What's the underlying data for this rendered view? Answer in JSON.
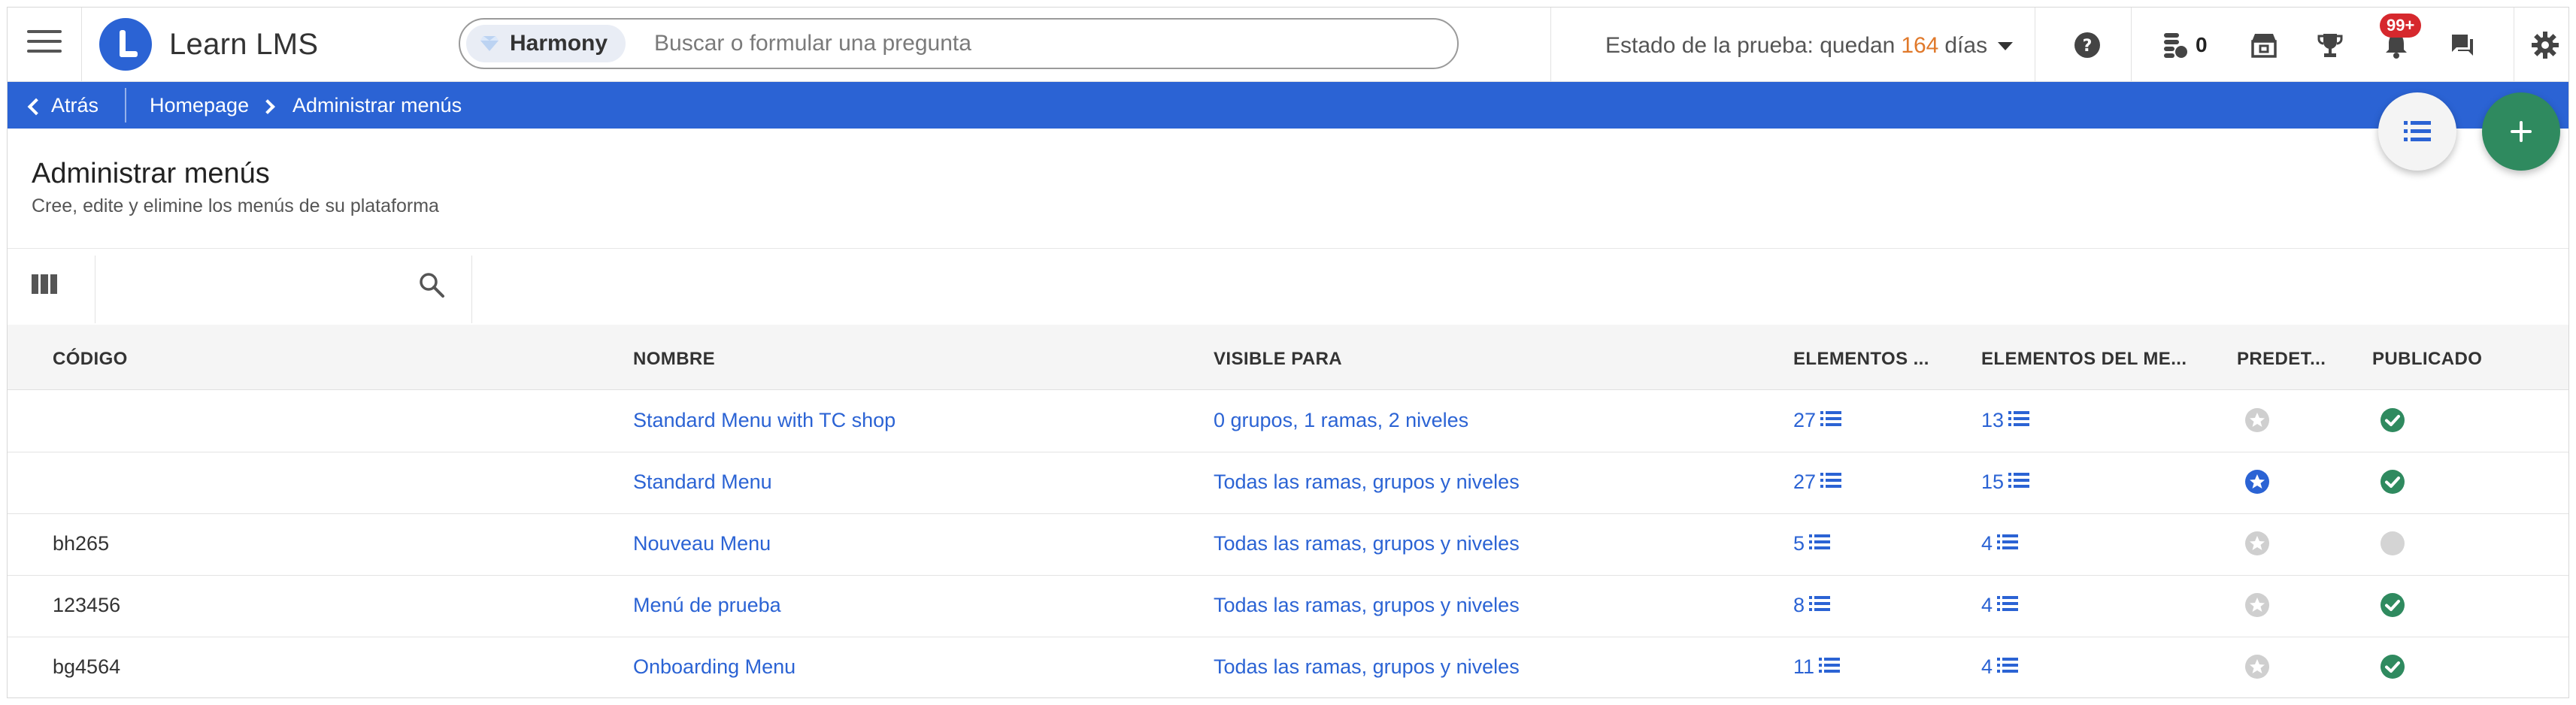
{
  "app": {
    "name": "Learn LMS"
  },
  "header": {
    "search_pill": "Harmony",
    "search_placeholder": "Buscar o formular una pregunta",
    "trial_prefix": "Estado de la prueba: quedan",
    "trial_days": "164",
    "trial_suffix": "días",
    "credits_count": "0",
    "notifications_badge": "99+"
  },
  "breadcrumb": {
    "back_label": "Atrás",
    "items": [
      "Homepage",
      "Administrar menús"
    ]
  },
  "page": {
    "title": "Administrar menús",
    "subtitle": "Cree, edite y elimine los menús de su plataforma"
  },
  "table": {
    "columns": [
      "CÓDIGO",
      "NOMBRE",
      "VISIBLE PARA",
      "ELEMENTOS ...",
      "ELEMENTOS DEL ME...",
      "PREDET...",
      "PUBLICADO"
    ],
    "rows": [
      {
        "code": "",
        "name": "Standard Menu with TC shop",
        "visible": "0 grupos, 1 ramas, 2 niveles",
        "items": "27",
        "menu_items": "13",
        "default": false,
        "published": true
      },
      {
        "code": "",
        "name": "Standard Menu",
        "visible": "Todas las ramas, grupos y niveles",
        "items": "27",
        "menu_items": "15",
        "default": true,
        "published": true
      },
      {
        "code": "bh265",
        "name": "Nouveau Menu",
        "visible": "Todas las ramas, grupos y niveles",
        "items": "5",
        "menu_items": "4",
        "default": false,
        "published": false
      },
      {
        "code": "123456",
        "name": "Menú de prueba",
        "visible": "Todas las ramas, grupos y niveles",
        "items": "8",
        "menu_items": "4",
        "default": false,
        "published": true
      },
      {
        "code": "bg4564",
        "name": "Onboarding Menu",
        "visible": "Todas las ramas, grupos y niveles",
        "items": "11",
        "menu_items": "4",
        "default": false,
        "published": true
      }
    ]
  },
  "colors": {
    "primary": "#2b63d4",
    "success": "#2f8a5f",
    "trial_days": "#e0792b",
    "badge": "#d6282d"
  }
}
